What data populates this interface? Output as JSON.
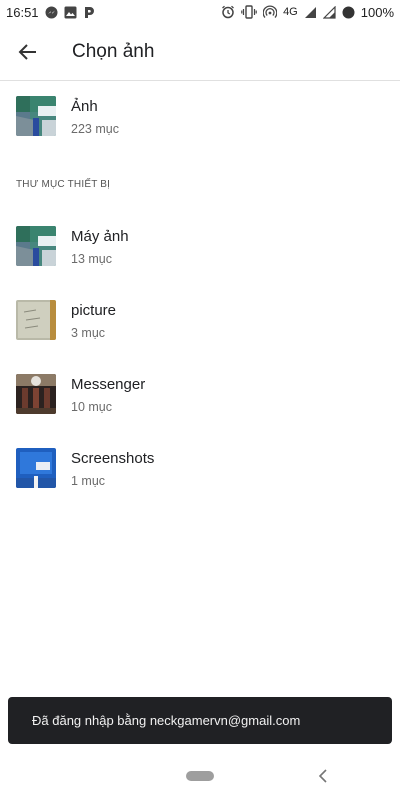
{
  "status_bar": {
    "time": "16:51",
    "network": "4G",
    "battery": "100%",
    "left_icons": [
      "messenger-icon",
      "image-icon",
      "parking-app-icon"
    ],
    "right_icons": [
      "alarm-icon",
      "vibrate-icon",
      "hotspot-icon",
      "signal-icon",
      "signal-icon",
      "battery-icon"
    ]
  },
  "app_bar": {
    "title": "Chọn ảnh",
    "back_icon": "arrow-back-icon"
  },
  "main_album": {
    "name": "Ảnh",
    "count": "223 mục"
  },
  "section": {
    "header": "THƯ MỤC THIẾT BỊ"
  },
  "albums": [
    {
      "name": "Máy ảnh",
      "count": "13 mục"
    },
    {
      "name": "picture",
      "count": "3 mục"
    },
    {
      "name": "Messenger",
      "count": "10 mục"
    },
    {
      "name": "Screenshots",
      "count": "1 mục"
    }
  ],
  "snackbar": {
    "text": "Đã đăng nhập bằng neckgamervn@gmail.com"
  },
  "colors": {
    "snackbar_bg": "#202124",
    "divider": "#e0e0e0",
    "secondary_text": "#6b6b6b"
  }
}
